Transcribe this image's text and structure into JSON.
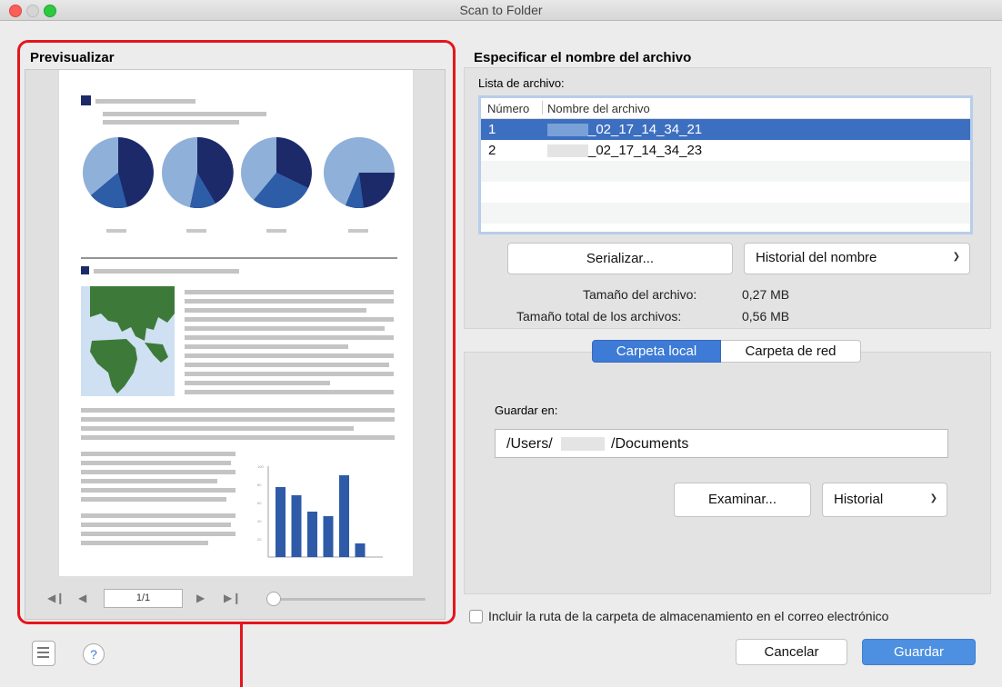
{
  "window": {
    "title": "Scan to Folder"
  },
  "preview": {
    "title": "Previsualizar",
    "page_indicator": "1/1",
    "zoom_level": 0.0
  },
  "file_section": {
    "title": "Especificar el nombre del archivo",
    "list_label": "Lista de archivo:",
    "columns": [
      "Número",
      "Nombre del archivo"
    ],
    "rows": [
      {
        "num": "1",
        "name": "_02_17_14_34_21",
        "selected": true
      },
      {
        "num": "2",
        "name": "_02_17_14_34_23",
        "selected": false
      }
    ],
    "serialize_label": "Serializar...",
    "name_history_label": "Historial del nombre",
    "file_size_label": "Tamaño del archivo:",
    "file_size_value": "0,27 MB",
    "total_size_label": "Tamaño total de los archivos:",
    "total_size_value": "0,56 MB"
  },
  "folder_section": {
    "tabs": [
      {
        "label": "Carpeta local",
        "active": true
      },
      {
        "label": "Carpeta de red",
        "active": false
      }
    ],
    "save_in_label": "Guardar en:",
    "path_start": "/Users/",
    "path_end": "/Documents",
    "browse_label": "Examinar...",
    "history_label": "Historial"
  },
  "options": {
    "include_path_label": "Incluir la ruta de la carpeta de almacenamiento en el correo electrónico",
    "include_path_checked": false
  },
  "footer": {
    "cancel_label": "Cancelar",
    "save_label": "Guardar",
    "help_icon_text": "?"
  },
  "colors": {
    "accent": "#3d7bd6",
    "highlight_red": "#e4161d",
    "pie_dark": "#1c2a6a",
    "pie_light": "#8fb0d8",
    "map_green": "#3d7a3a"
  },
  "document_bar_chart": {
    "ticks": [
      "100",
      "80",
      "60",
      "40",
      "20"
    ],
    "values": [
      77,
      68,
      50,
      45,
      90,
      15
    ]
  }
}
